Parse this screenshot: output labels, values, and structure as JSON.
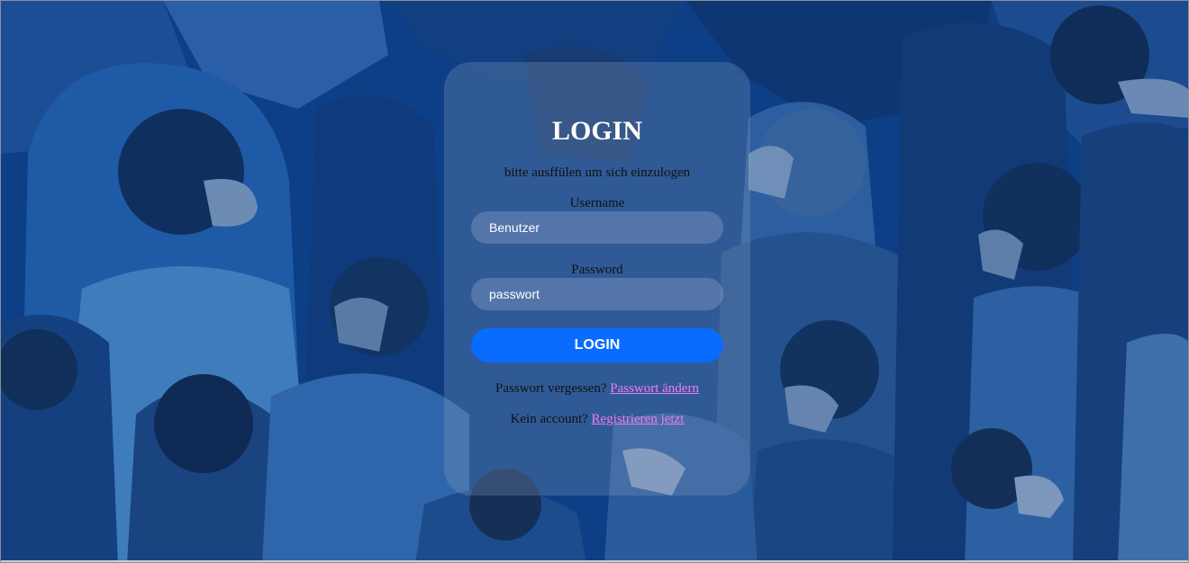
{
  "login": {
    "title": "LOGIN",
    "subtitle": "bitte ausffülen um sich einzulogen",
    "username_label": "Username",
    "username_value": "Benutzer",
    "password_label": "Password",
    "password_value": "passwort",
    "submit_label": "LOGIN",
    "forgot_text": "Passwort vergessen?",
    "forgot_link": "Passwort ändern",
    "register_text": "Kein account?",
    "register_link": "Registrieren jetzt"
  },
  "colors": {
    "background": "#0b3a7a",
    "button": "#0a6cff",
    "link": "#f07bf0",
    "title": "#ffffff"
  }
}
